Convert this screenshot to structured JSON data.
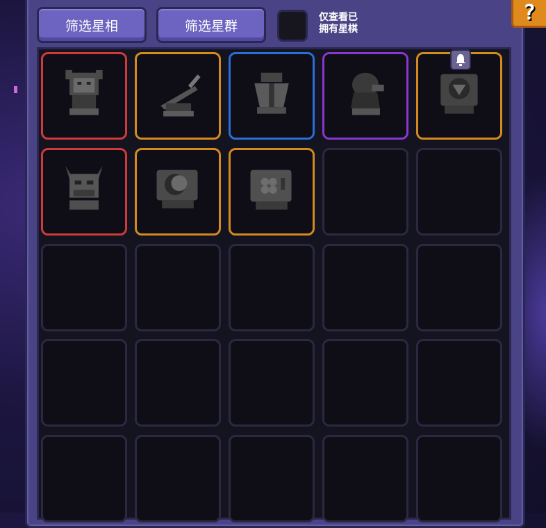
{
  "filters": {
    "aspect_label": "筛选星相",
    "constellation_label": "筛选星群",
    "owned_only_label_line1": "仅查看已",
    "owned_only_label_line2": "拥有星棋",
    "owned_only_checked": false
  },
  "help_label": "?",
  "slots": [
    {
      "rarity": "red",
      "icon": "demon-bust-icon"
    },
    {
      "rarity": "orange",
      "icon": "blade-pedestal-icon"
    },
    {
      "rarity": "blue",
      "icon": "armor-statue-icon"
    },
    {
      "rarity": "purple",
      "icon": "hooded-figure-icon"
    },
    {
      "rarity": "orange",
      "icon": "orb-pedestal-icon",
      "badge": "bell-icon"
    },
    {
      "rarity": "red",
      "icon": "horned-demon-icon"
    },
    {
      "rarity": "orange",
      "icon": "moon-pedestal-icon"
    },
    {
      "rarity": "orange",
      "icon": "clover-safe-icon"
    },
    {
      "rarity": "empty"
    },
    {
      "rarity": "empty"
    },
    {
      "rarity": "empty"
    },
    {
      "rarity": "empty"
    },
    {
      "rarity": "empty"
    },
    {
      "rarity": "empty"
    },
    {
      "rarity": "empty"
    },
    {
      "rarity": "empty"
    },
    {
      "rarity": "empty"
    },
    {
      "rarity": "empty"
    },
    {
      "rarity": "empty"
    },
    {
      "rarity": "empty"
    },
    {
      "rarity": "empty"
    },
    {
      "rarity": "empty"
    },
    {
      "rarity": "empty"
    },
    {
      "rarity": "empty"
    },
    {
      "rarity": "empty"
    }
  ],
  "colors": {
    "red": "#d03a3a",
    "orange": "#d48a1e",
    "blue": "#2a6ed8",
    "purple": "#8a36d0",
    "panel": "#4a4486"
  }
}
